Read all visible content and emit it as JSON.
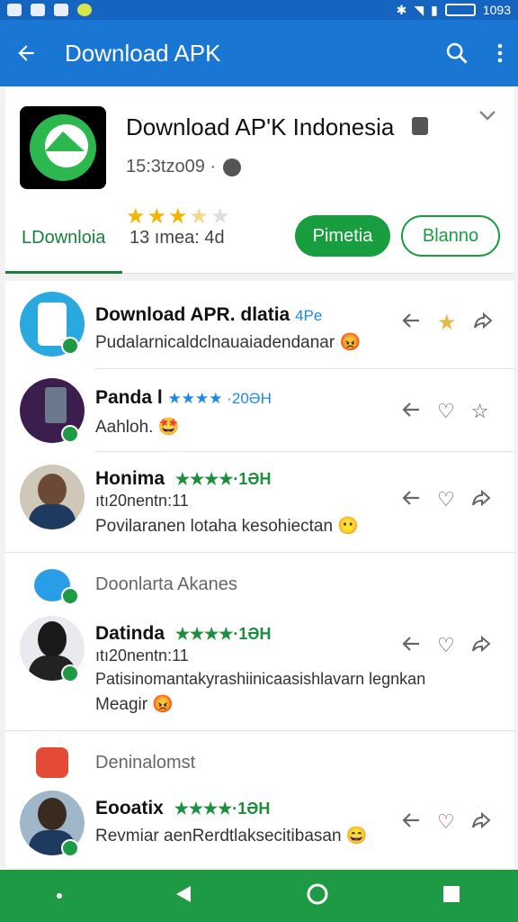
{
  "status_bar": {
    "time": "1093"
  },
  "app_bar": {
    "title": "Download APK"
  },
  "app_card": {
    "title": "Download AP'K Indonesia",
    "subtitle": "15:3tzo09 ·",
    "tab_label": "LDownloia",
    "rating_text": "13 ımea: 4d",
    "primary_button": "Pimetia",
    "secondary_button": "Blanno",
    "stars": "★★★★★"
  },
  "list": {
    "rows": [
      {
        "name": "Download APR. dlatia",
        "tag": "4Pe",
        "line2": "Pudalarnicaldclnauaiadendanar 😡"
      },
      {
        "name": "Panda l",
        "stars": "★★★★ ·20ƏH",
        "line2": "Aahloh. 🤩"
      },
      {
        "name": "Honima",
        "stars": "★★★★·1ƏH",
        "line2": "ıtı20nentn:11",
        "line3": "Povilaranen lotaha kesohiectan 😶"
      },
      {
        "section": "Doonlarta Akanes"
      },
      {
        "name": "Datinda",
        "stars": "★★★★·1ƏH",
        "line2": "ıtı20nentn:11",
        "line3": "Patisinomantakyrashiinicaasishlavarn legnkan",
        "line4": "Meagir 😡"
      },
      {
        "section": "Deninalomst"
      },
      {
        "name": "Eooatix",
        "stars": "★★★★·1ƏH",
        "line2": "Revmiar aenRerdtlaksecitibasan 😄"
      }
    ]
  },
  "colors": {
    "primary": "#1976d2",
    "green": "#189d3f",
    "star": "#f4b400"
  }
}
